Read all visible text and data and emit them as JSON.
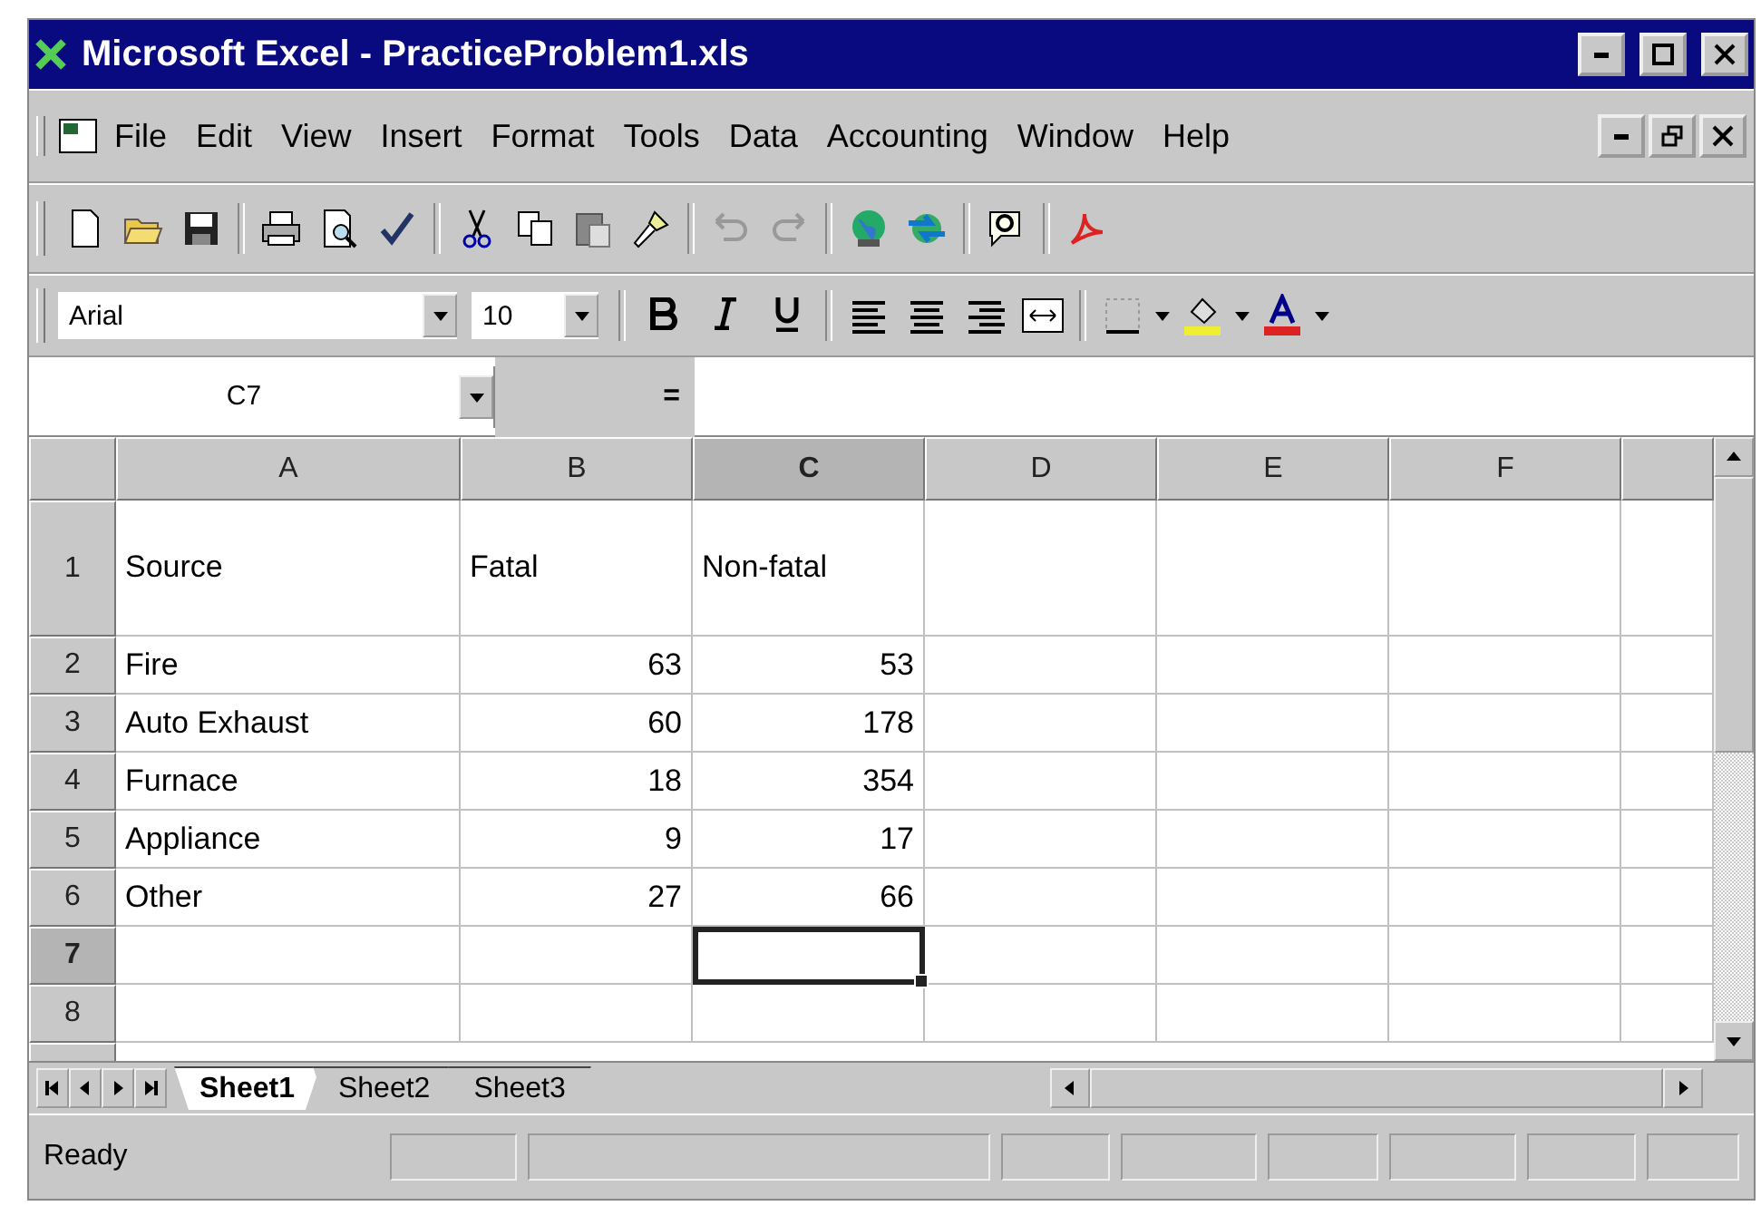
{
  "window": {
    "title": "Microsoft Excel - PracticeProblem1.xls"
  },
  "menu": [
    "File",
    "Edit",
    "View",
    "Insert",
    "Format",
    "Tools",
    "Data",
    "Accounting",
    "Window",
    "Help"
  ],
  "formatting": {
    "font": "Arial",
    "size": "10"
  },
  "formula_bar": {
    "name_box": "C7",
    "equals": "="
  },
  "columns": [
    {
      "label": "A",
      "selected": false
    },
    {
      "label": "B",
      "selected": false
    },
    {
      "label": "C",
      "selected": true
    },
    {
      "label": "D",
      "selected": false
    },
    {
      "label": "E",
      "selected": false
    },
    {
      "label": "F",
      "selected": false
    }
  ],
  "rows": [
    {
      "number": "1",
      "kind": "heading",
      "selected": false,
      "cells": [
        {
          "text": "Source",
          "active": false
        },
        {
          "text": "Fatal",
          "active": false
        },
        {
          "text": "Non-fatal",
          "active": false
        }
      ]
    },
    {
      "number": "2",
      "kind": "data",
      "selected": false,
      "cells": [
        {
          "text": "Fire",
          "active": false
        },
        {
          "text": "63",
          "active": false
        },
        {
          "text": "53",
          "active": false
        }
      ]
    },
    {
      "number": "3",
      "kind": "data",
      "selected": false,
      "cells": [
        {
          "text": "Auto Exhaust",
          "active": false
        },
        {
          "text": "60",
          "active": false
        },
        {
          "text": "178",
          "active": false
        }
      ]
    },
    {
      "number": "4",
      "kind": "data",
      "selected": false,
      "cells": [
        {
          "text": "Furnace",
          "active": false
        },
        {
          "text": "18",
          "active": false
        },
        {
          "text": "354",
          "active": false
        }
      ]
    },
    {
      "number": "5",
      "kind": "data",
      "selected": false,
      "cells": [
        {
          "text": "Appliance",
          "active": false
        },
        {
          "text": "9",
          "active": false
        },
        {
          "text": "17",
          "active": false
        }
      ]
    },
    {
      "number": "6",
      "kind": "data",
      "selected": false,
      "cells": [
        {
          "text": "Other",
          "active": false
        },
        {
          "text": "27",
          "active": false
        },
        {
          "text": "66",
          "active": false
        }
      ]
    },
    {
      "number": "7",
      "kind": "data",
      "selected": true,
      "cells": [
        {
          "active": false
        },
        {
          "active": false
        },
        {
          "active": true
        }
      ]
    },
    {
      "number": "8",
      "kind": "data",
      "selected": false,
      "cells": [
        {
          "active": false
        },
        {
          "active": false
        },
        {
          "active": false
        }
      ]
    }
  ],
  "sheet_tabs": [
    {
      "label": "Sheet1",
      "selected": true
    },
    {
      "label": "Sheet2",
      "selected": false
    },
    {
      "label": "Sheet3",
      "selected": false
    }
  ],
  "status_bar": {
    "text": "Ready"
  }
}
